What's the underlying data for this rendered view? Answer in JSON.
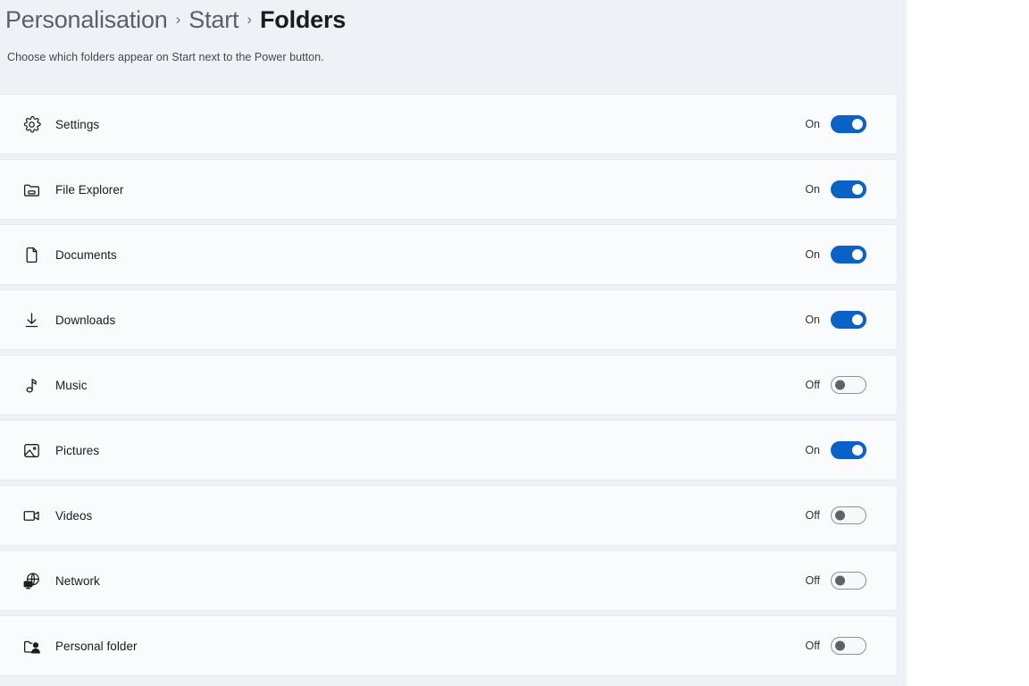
{
  "breadcrumb": {
    "items": [
      {
        "label": "Personalisation",
        "current": false
      },
      {
        "label": "Start",
        "current": false
      },
      {
        "label": "Folders",
        "current": true
      }
    ],
    "separator": "›"
  },
  "page": {
    "subtitle": "Choose which folders appear on Start next to the Power button."
  },
  "colors": {
    "page_background": "#eef1f6",
    "card_background": "#fafbfc",
    "accent_on": "#0a62c9",
    "toggle_off_border": "#8d9198",
    "toggle_off_knob": "#5d6168",
    "text_primary": "#1b1b1b",
    "text_secondary": "#5b5f66"
  },
  "rows": [
    {
      "label": "Settings",
      "icon": "gear-icon",
      "state": "On",
      "on": true
    },
    {
      "label": "File Explorer",
      "icon": "folder-icon",
      "state": "On",
      "on": true
    },
    {
      "label": "Documents",
      "icon": "document-icon",
      "state": "On",
      "on": true
    },
    {
      "label": "Downloads",
      "icon": "download-icon",
      "state": "On",
      "on": true
    },
    {
      "label": "Music",
      "icon": "music-note-icon",
      "state": "Off",
      "on": false
    },
    {
      "label": "Pictures",
      "icon": "picture-icon",
      "state": "On",
      "on": true
    },
    {
      "label": "Videos",
      "icon": "video-camera-icon",
      "state": "Off",
      "on": false
    },
    {
      "label": "Network",
      "icon": "network-globe-icon",
      "state": "Off",
      "on": false
    },
    {
      "label": "Personal folder",
      "icon": "personal-folder-icon",
      "state": "Off",
      "on": false
    }
  ]
}
